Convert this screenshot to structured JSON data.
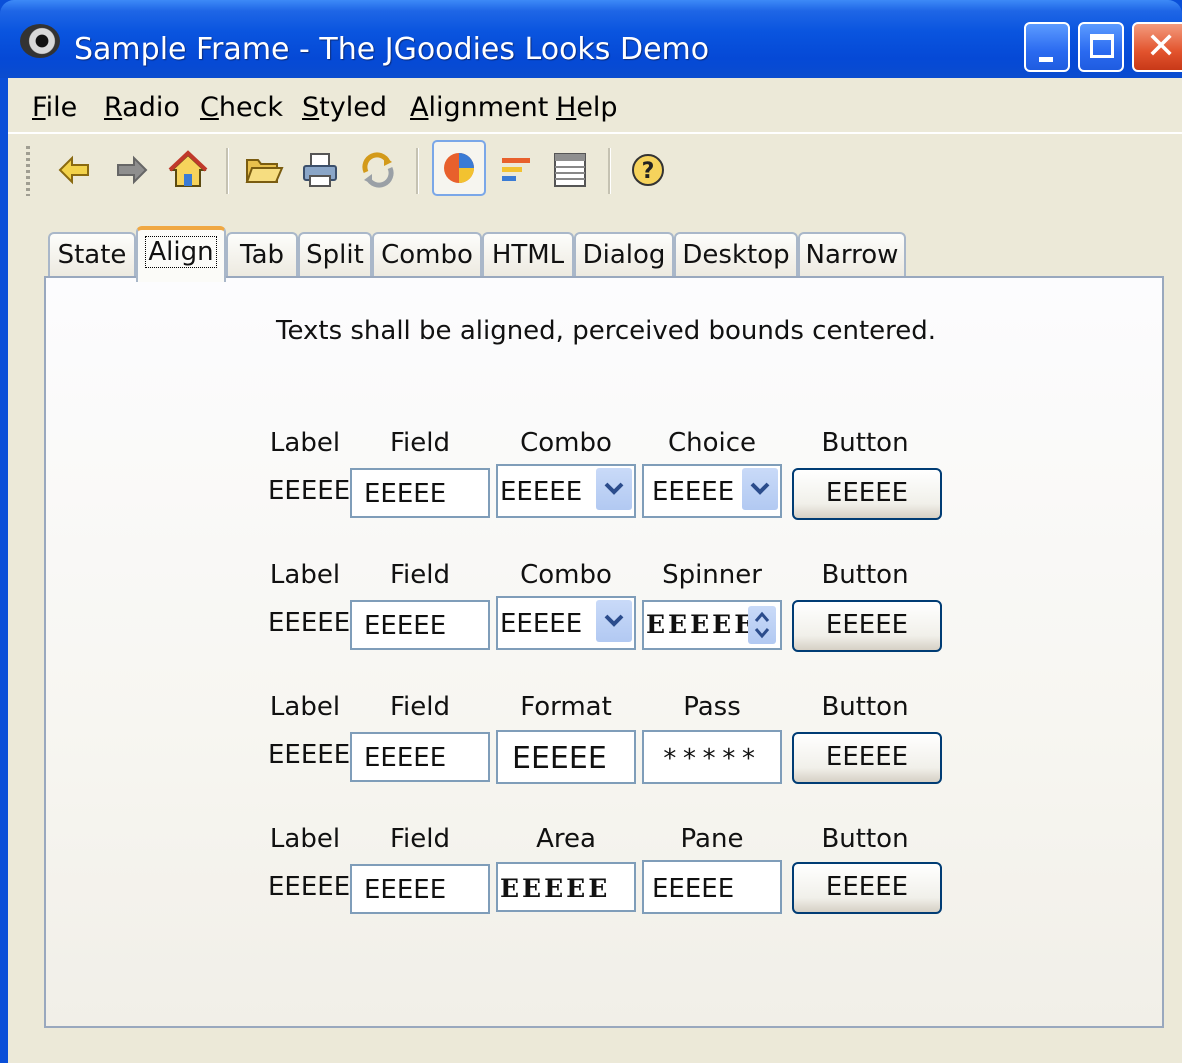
{
  "window": {
    "title": "Sample Frame - The JGoodies Looks Demo",
    "buttons": [
      "minimize",
      "maximize",
      "close"
    ]
  },
  "menu": {
    "items": [
      {
        "label": "File",
        "mnemonic": "F",
        "rest": "ile"
      },
      {
        "label": "Radio",
        "mnemonic": "R",
        "rest": "adio"
      },
      {
        "label": "Check",
        "mnemonic": "C",
        "rest": "heck"
      },
      {
        "label": "Styled",
        "mnemonic": "S",
        "rest": "tyled"
      },
      {
        "label": "Alignment",
        "mnemonic": "A",
        "rest": "lignment"
      },
      {
        "label": "Help",
        "mnemonic": "H",
        "rest": "elp"
      }
    ]
  },
  "toolbar": {
    "icons": [
      "back-arrow-icon",
      "forward-arrow-icon",
      "home-icon",
      "open-folder-icon",
      "print-icon",
      "refresh-icon",
      "pie-chart-icon",
      "bar-chart-icon",
      "table-icon",
      "help-icon"
    ],
    "selected": "pie-chart-icon"
  },
  "tabs": {
    "items": [
      "State",
      "Align",
      "Tab",
      "Split",
      "Combo",
      "HTML",
      "Dialog",
      "Desktop",
      "Narrow"
    ],
    "active": "Align"
  },
  "panel": {
    "heading": "Texts shall be aligned, perceived bounds centered.",
    "rows": [
      {
        "headers": [
          "Label",
          "Field",
          "Combo",
          "Choice",
          "Button"
        ],
        "label": "EEEEE",
        "field": "EEEEE",
        "combo": "EEEEE",
        "col4": "EEEEE",
        "button": "EEEEE"
      },
      {
        "headers": [
          "Label",
          "Field",
          "Combo",
          "Spinner",
          "Button"
        ],
        "label": "EEEEE",
        "field": "EEEEE",
        "combo": "EEEEE",
        "col4": "EEEEE",
        "button": "EEEEE"
      },
      {
        "headers": [
          "Label",
          "Field",
          "Format",
          "Pass",
          "Button"
        ],
        "label": "EEEEE",
        "field": "EEEEE",
        "combo": "EEEEE",
        "col4": "*****",
        "button": "EEEEE"
      },
      {
        "headers": [
          "Label",
          "Field",
          "Area",
          "Pane",
          "Button"
        ],
        "label": "EEEEE",
        "field": "EEEEE",
        "combo": "EEEEE",
        "col4": "EEEEE",
        "button": "EEEEE"
      }
    ]
  },
  "colors": {
    "titlebar": "#0A55DF",
    "client": "#ECE9D8",
    "field_border": "#7F9DB9",
    "active_tab_accent": "#F0A843"
  }
}
